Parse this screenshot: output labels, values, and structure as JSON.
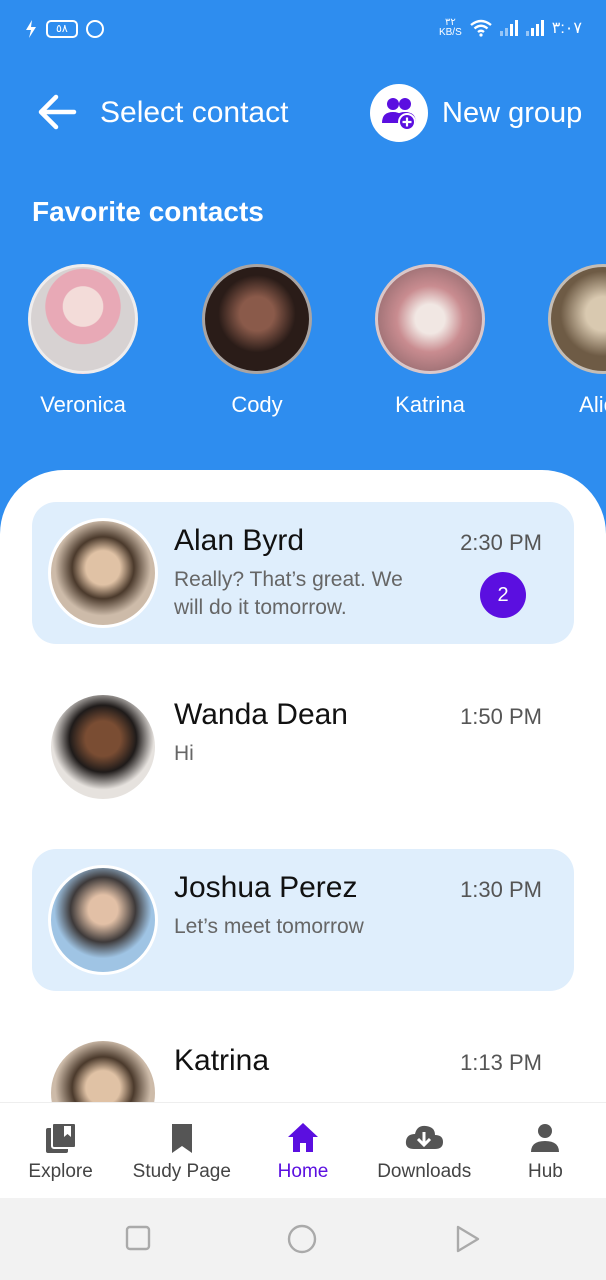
{
  "status_bar": {
    "battery": "٥٨",
    "network_speed_value": "٣٢",
    "network_speed_unit": "KB/S",
    "time": "٣:٠٧"
  },
  "header": {
    "title": "Select contact",
    "new_group_label": "New group",
    "back_icon": "arrow-left-icon",
    "new_group_icon": "group-add-icon"
  },
  "favorites": {
    "title": "Favorite contacts",
    "contacts": [
      {
        "name": "Veronica",
        "avatar_color": "#d9c7cc"
      },
      {
        "name": "Cody",
        "avatar_color": "#3a2a25"
      },
      {
        "name": "Katrina",
        "avatar_color": "#c9a7a8"
      },
      {
        "name": "Alice",
        "avatar_color": "#8a7a60"
      }
    ]
  },
  "chats": [
    {
      "name": "Alan Byrd",
      "time": "2:30 PM",
      "message": "Really? That’s great. We will do it tomorrow.",
      "unread": "2",
      "highlighted": true,
      "avatar_color": "#7b6a55"
    },
    {
      "name": "Wanda Dean",
      "time": "1:50 PM",
      "message": "Hi",
      "unread": "",
      "highlighted": false,
      "avatar_color": "#3b3530"
    },
    {
      "name": "Joshua Perez",
      "time": "1:30 PM",
      "message": "Let’s meet tomorrow",
      "unread": "",
      "highlighted": true,
      "avatar_color": "#5e7fa0"
    },
    {
      "name": "Katrina",
      "time": "1:13 PM",
      "message": "",
      "unread": "",
      "highlighted": false,
      "avatar_color": "#7b6a55"
    }
  ],
  "bottom_nav": {
    "active": "Home",
    "items": [
      {
        "label": "Explore",
        "icon": "library-icon"
      },
      {
        "label": "Study Page",
        "icon": "bookmark-icon"
      },
      {
        "label": "Home",
        "icon": "home-icon"
      },
      {
        "label": "Downloads",
        "icon": "cloud-download-icon"
      },
      {
        "label": "Hub",
        "icon": "person-icon"
      }
    ]
  },
  "colors": {
    "primary": "#2e8def",
    "accent": "#5b0fe0",
    "highlight": "#dfeefc"
  }
}
